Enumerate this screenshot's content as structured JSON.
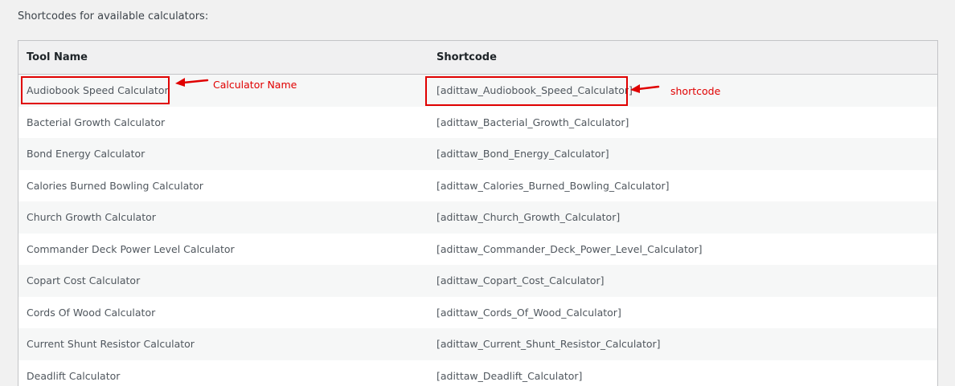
{
  "intro_text": "Shortcodes for available calculators:",
  "table": {
    "headers": {
      "tool_name": "Tool Name",
      "shortcode": "Shortcode"
    },
    "rows": [
      {
        "name": "Audiobook Speed Calculator",
        "code": "[adittaw_Audiobook_Speed_Calculator]"
      },
      {
        "name": "Bacterial Growth Calculator",
        "code": "[adittaw_Bacterial_Growth_Calculator]"
      },
      {
        "name": "Bond Energy Calculator",
        "code": "[adittaw_Bond_Energy_Calculator]"
      },
      {
        "name": "Calories Burned Bowling Calculator",
        "code": "[adittaw_Calories_Burned_Bowling_Calculator]"
      },
      {
        "name": "Church Growth Calculator",
        "code": "[adittaw_Church_Growth_Calculator]"
      },
      {
        "name": "Commander Deck Power Level Calculator",
        "code": "[adittaw_Commander_Deck_Power_Level_Calculator]"
      },
      {
        "name": "Copart Cost Calculator",
        "code": "[adittaw_Copart_Cost_Calculator]"
      },
      {
        "name": "Cords Of Wood Calculator",
        "code": "[adittaw_Cords_Of_Wood_Calculator]"
      },
      {
        "name": "Current Shunt Resistor Calculator",
        "code": "[adittaw_Current_Shunt_Resistor_Calculator]"
      },
      {
        "name": "Deadlift Calculator",
        "code": "[adittaw_Deadlift_Calculator]"
      }
    ]
  },
  "annotations": {
    "name_label": "Calculator Name",
    "code_label": "shortcode",
    "color": "#e00000"
  }
}
